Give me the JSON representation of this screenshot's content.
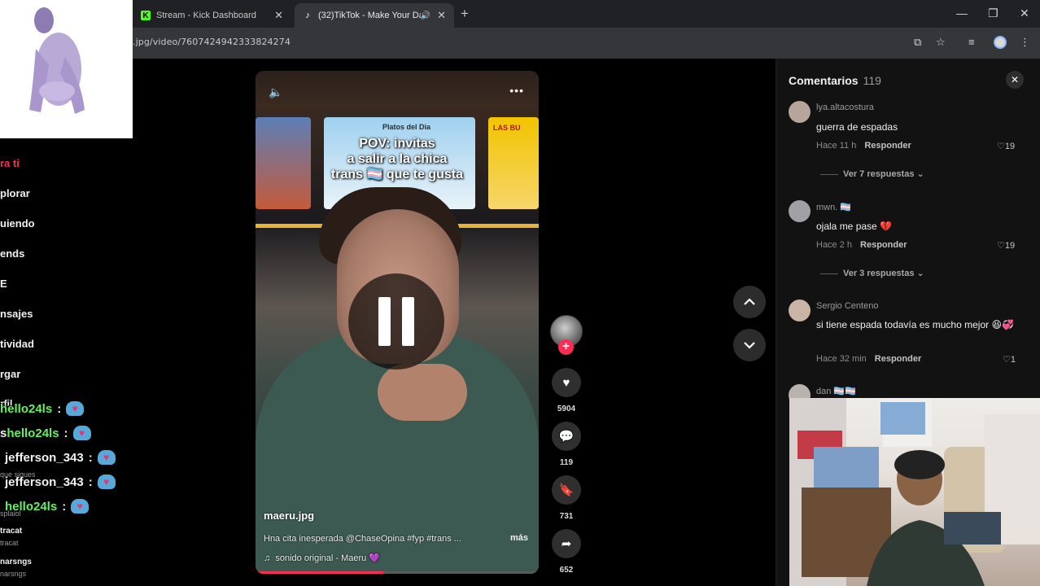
{
  "browser": {
    "tabs": [
      {
        "label": "Stream - Kick Dashboard",
        "favicon": "kick-icon",
        "active": false
      },
      {
        "label": "(32)TikTok - Make Your Day",
        "favicon": "tiktok-icon",
        "active": true
      }
    ],
    "url": ".jpg/video/7607424942333824274"
  },
  "sidebar": {
    "items": [
      "ra ti",
      "plorar",
      "uiendo",
      "ends",
      "E",
      "nsajes",
      "tividad",
      "rgar"
    ]
  },
  "chat": {
    "messages": [
      {
        "user": "hello24ls",
        "sep": ":",
        "prefix": ""
      },
      {
        "user": "hello24ls",
        "sep": ":",
        "prefix": "s"
      },
      {
        "user": "jefferson_343",
        "sep": ":",
        "prefix": ""
      },
      {
        "user": "jefferson_343",
        "sep": ":",
        "prefix": ""
      },
      {
        "user": "hello24ls",
        "sep": ":",
        "prefix": ""
      }
    ],
    "partial_label": "rfil",
    "follow_hint": "que sigues",
    "partial_name": "splaiol",
    "followers": [
      {
        "name": "tracat",
        "sub": "tracat"
      },
      {
        "name": "narsngs",
        "sub": "narsngs"
      }
    ]
  },
  "video": {
    "caption": [
      "POV: invitas",
      "a salir a la chica",
      "trans 🏳️‍⚧️ que te gusta"
    ],
    "author": "maeru.jpg",
    "description": "Hna cita inesperada @ChaseOpina #fyp #trans ...",
    "more_label": "más",
    "music": "sonido original - Maeru 💜",
    "progress": 0.45,
    "board_label": "Platos del Dia",
    "board_label_2": "LAS BU"
  },
  "actions": {
    "likes": "5904",
    "comments": "119",
    "saves": "731",
    "shares": "652"
  },
  "comments_panel": {
    "title": "Comentarios",
    "count": "119",
    "items": [
      {
        "user": "lya.altacostura",
        "text": "guerra de espadas",
        "time": "Hace 11 h",
        "reply": "Responder",
        "likes": "19",
        "replies": "Ver 7 respuestas"
      },
      {
        "user": "mwn. 🏳️‍⚧️",
        "text": "ojala me pase 💔",
        "time": "Hace 2 h",
        "reply": "Responder",
        "likes": "19",
        "replies": "Ver 3 respuestas"
      },
      {
        "user": "Sergio Centeno",
        "text": "si tiene espada todavía es mucho mejor 😆💞",
        "time": "Hace 32 min",
        "reply": "Responder",
        "likes": "1",
        "replies": ""
      },
      {
        "user": "dan 🏳️‍⚧️🏳️‍⚧️",
        "text": "",
        "time": "",
        "reply": "",
        "likes": "",
        "replies": ""
      }
    ]
  },
  "colors": {
    "tiktok_red": "#fe2c55",
    "kick_green": "#53fc18",
    "chat_green": "#62f05f"
  }
}
